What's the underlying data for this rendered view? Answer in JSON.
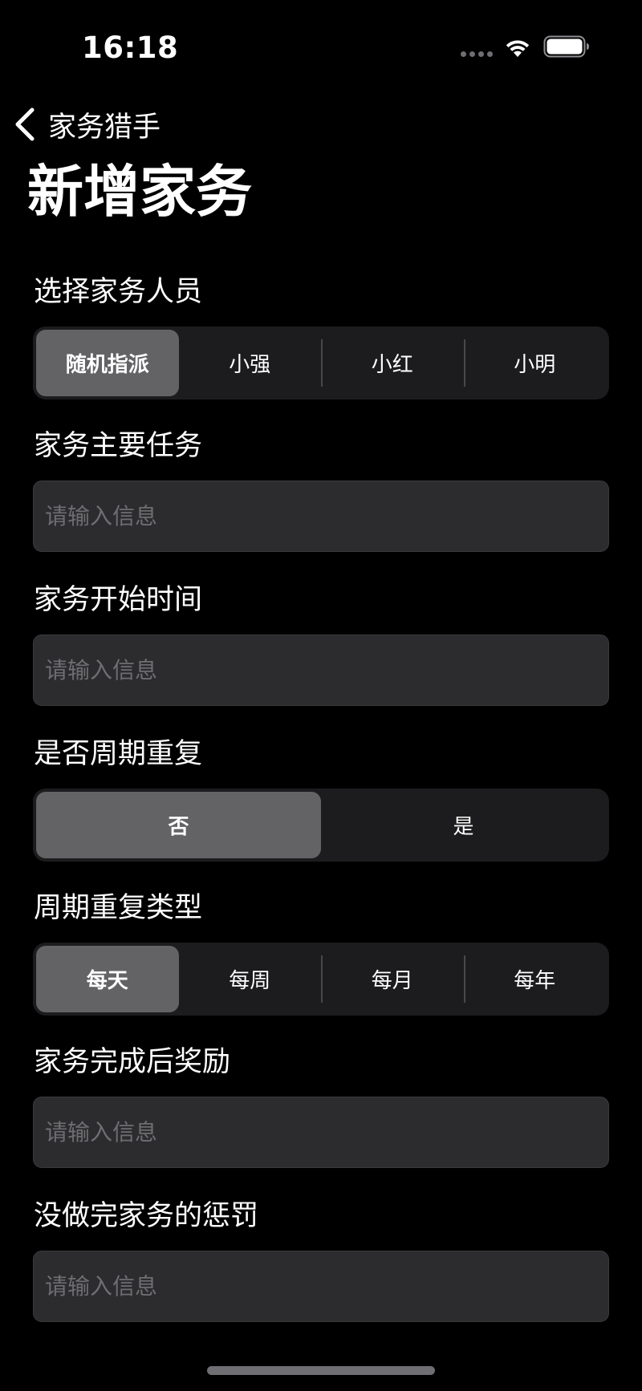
{
  "status_bar": {
    "time": "16:18",
    "signal_icon": "cellular-dots-icon",
    "wifi_icon": "wifi-icon",
    "battery_icon": "battery-icon"
  },
  "nav": {
    "back_icon": "chevron-left-icon",
    "back_label": "家务猎手"
  },
  "page": {
    "title": "新增家务"
  },
  "form": {
    "assignee": {
      "label": "选择家务人员",
      "options": [
        "随机指派",
        "小强",
        "小红",
        "小明"
      ],
      "selected": "随机指派"
    },
    "main_task": {
      "label": "家务主要任务",
      "placeholder": "请输入信息",
      "value": ""
    },
    "start_time": {
      "label": "家务开始时间",
      "placeholder": "请输入信息",
      "value": ""
    },
    "repeat": {
      "label": "是否周期重复",
      "options": [
        "否",
        "是"
      ],
      "selected": "否"
    },
    "repeat_type": {
      "label": "周期重复类型",
      "options": [
        "每天",
        "每周",
        "每月",
        "每年"
      ],
      "selected": "每天"
    },
    "reward": {
      "label": "家务完成后奖励",
      "placeholder": "请输入信息",
      "value": ""
    },
    "penalty": {
      "label": "没做完家务的惩罚",
      "placeholder": "请输入信息",
      "value": ""
    }
  },
  "colors": {
    "background": "#000000",
    "segment_bg": "#1c1c1e",
    "segment_selected": "#636366",
    "input_bg": "#2c2c2e",
    "placeholder": "#6e6e72"
  }
}
